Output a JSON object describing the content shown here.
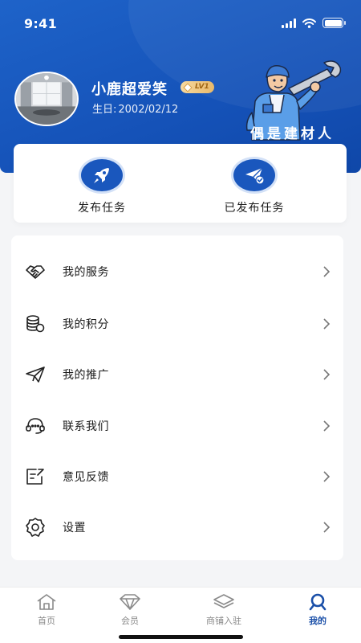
{
  "status_bar": {
    "time": "9:41",
    "icons": [
      "signal-icon",
      "wifi-icon",
      "battery-icon"
    ]
  },
  "profile": {
    "username": "小鹿超爱笑",
    "level": "LV1",
    "birthday_label": "生日:",
    "birthday": "2002/02/12",
    "slogan": "偶是建材人"
  },
  "tasks": [
    {
      "label": "发布任务",
      "icon": "rocket-icon"
    },
    {
      "label": "已发布任务",
      "icon": "paper-plane-check-icon"
    }
  ],
  "menu": [
    {
      "label": "我的服务",
      "icon": "handshake-icon"
    },
    {
      "label": "我的积分",
      "icon": "coins-icon"
    },
    {
      "label": "我的推广",
      "icon": "send-icon"
    },
    {
      "label": "联系我们",
      "icon": "headset-icon"
    },
    {
      "label": "意见反馈",
      "icon": "feedback-icon"
    },
    {
      "label": "设置",
      "icon": "gear-icon"
    }
  ],
  "tabbar": [
    {
      "label": "首页",
      "icon": "home-icon",
      "active": false
    },
    {
      "label": "会员",
      "icon": "diamond-icon",
      "active": false
    },
    {
      "label": "商铺入驻",
      "icon": "layers-icon",
      "active": false
    },
    {
      "label": "我的",
      "icon": "profile-icon",
      "active": true
    }
  ],
  "colors": {
    "primary": "#1552b8",
    "active_tab": "#1a4fa8",
    "badge": "#e9b96a"
  }
}
